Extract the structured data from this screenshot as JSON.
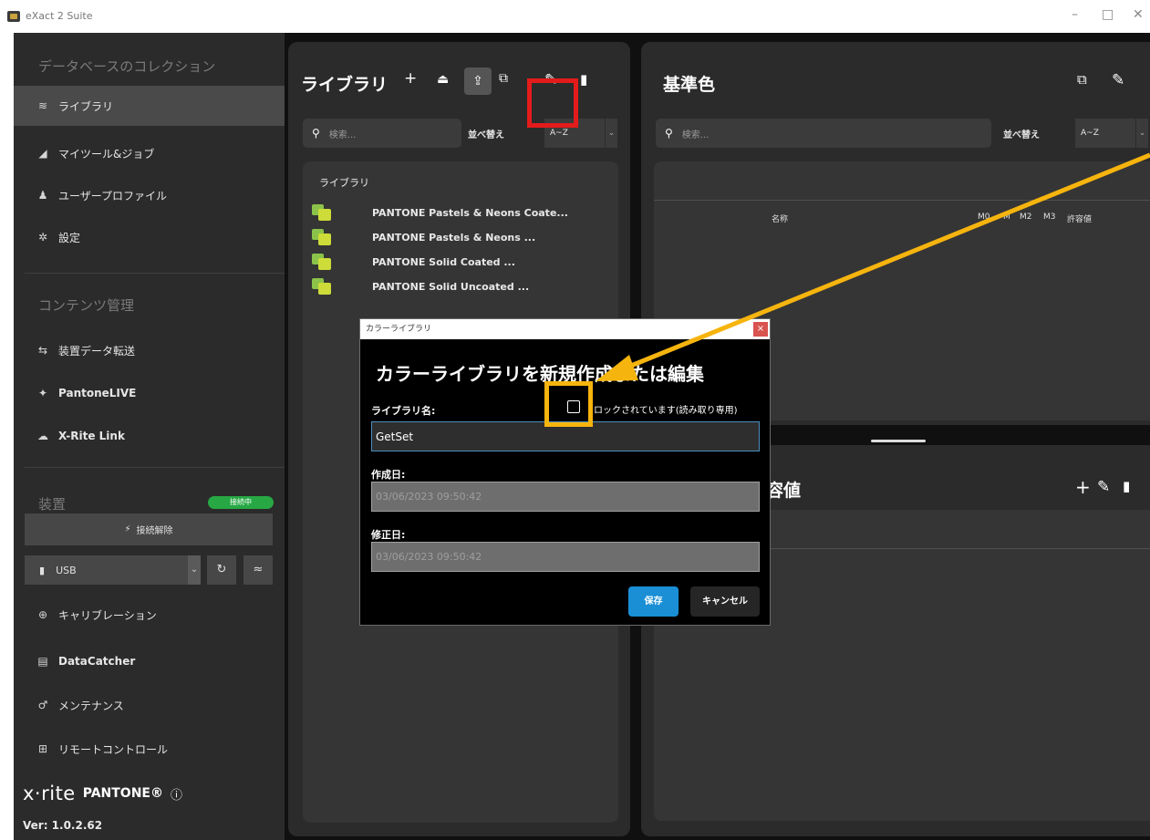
{
  "window": {
    "title": "eXact 2 Suite",
    "minimize": "–",
    "maximize": "□",
    "close": "✕"
  },
  "sidebar": {
    "section_collection": "データベースのコレクション",
    "items_collection": [
      {
        "icon": "library-icon",
        "glyph": "≋",
        "label": "ライブラリ",
        "active": true
      },
      {
        "icon": "jobs-icon",
        "glyph": "◢",
        "label": "マイツール&ジョブ",
        "active": false
      },
      {
        "icon": "user-icon",
        "glyph": "♟",
        "label": "ユーザープロファイル",
        "active": false
      },
      {
        "icon": "gear-icon",
        "glyph": "✲",
        "label": "設定",
        "active": false
      }
    ],
    "section_content": "コンテンツ管理",
    "items_content": [
      {
        "icon": "transfer-icon",
        "glyph": "⇆",
        "label": "装置データ転送"
      },
      {
        "icon": "pantonelive-icon",
        "glyph": "✦",
        "label": "PantoneLIVE"
      },
      {
        "icon": "cloud-icon",
        "glyph": "☁",
        "label": "X-Rite Link"
      }
    ],
    "section_device": "装置",
    "device_badge": "接続中",
    "disconnect_label": "接続解除",
    "usb_label": "USB",
    "refresh_glyph": "↻",
    "wifi_glyph": "≈",
    "items_device": [
      {
        "icon": "calibration-icon",
        "glyph": "⊕",
        "label": "キャリブレーション"
      },
      {
        "icon": "datacatcher-icon",
        "glyph": "▤",
        "label": "DataCatcher"
      },
      {
        "icon": "maintenance-icon",
        "glyph": "♂",
        "label": "メンテナンス"
      },
      {
        "icon": "remote-icon",
        "glyph": "⊞",
        "label": "リモートコントロール"
      }
    ],
    "logo_xrite": "x·rite",
    "logo_pantone": "PANTONE®",
    "version": "Ver: 1.0.2.62"
  },
  "library_panel": {
    "title": "ライブラリ",
    "search_placeholder": "検索...",
    "sort_label": "並べ替え",
    "sort_value": "A~Z",
    "list_header": "ライブラリ",
    "items": [
      "PANTONE Pastels & Neons Coate...",
      "PANTONE Pastels & Neons ...",
      "PANTONE Solid Coated ...",
      "PANTONE Solid Uncoated ..."
    ]
  },
  "standards_panel": {
    "title": "基準色",
    "search_placeholder": "検索...",
    "sort_label": "並べ替え",
    "sort_value": "A~Z",
    "columns": [
      "名称",
      "M0",
      "M",
      "M2",
      "M3",
      "許容値"
    ]
  },
  "tolerance_panel": {
    "title": "許容値"
  },
  "dialog": {
    "title": "カラーライブラリ",
    "heading": "カラーライブラリを新規作成または編集",
    "name_label": "ライブラリ名:",
    "lock_label": "ロックされています(読み取り専用)",
    "name_value": "GetSet",
    "created_label": "作成日:",
    "created_value": "03/06/2023 09:50:42",
    "modified_label": "修正日:",
    "modified_value": "03/06/2023 09:50:42",
    "save_label": "保存",
    "cancel_label": "キャンセル"
  },
  "colors": {
    "highlight_red": "#e41b1b",
    "highlight_orange": "#f6b40e",
    "accent_blue": "#1a8fd6",
    "status_green": "#27a844"
  }
}
